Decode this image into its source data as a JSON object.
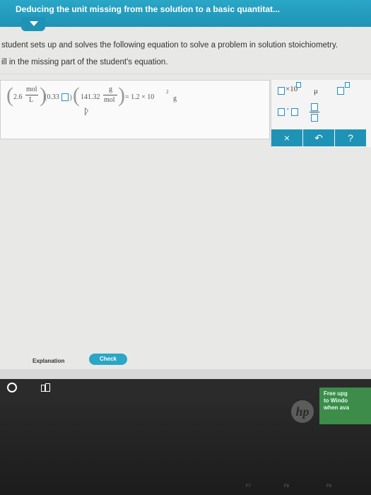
{
  "header": {
    "title": "Deducing the unit missing from the solution to a basic quantitat..."
  },
  "question": {
    "line1": "student sets up and solves the following equation to solve a problem in solution stoichiometry.",
    "line2": "ill in the missing part of the student's equation."
  },
  "equation": {
    "coef1": "2.6",
    "unit1_num": "mol",
    "unit1_den": "L",
    "term2": "(0.33",
    "coef3": "141.32",
    "unit3_num": "g",
    "unit3_den": "mol",
    "result": "= 1.2 × 10",
    "result_exp": "2",
    "result_unit": "g"
  },
  "palette": {
    "sci_label": "×10",
    "mu_label": "μ",
    "dot_label": "·",
    "clear_label": "×",
    "undo_label": "↶",
    "help_label": "?"
  },
  "buttons": {
    "explanation": "Explanation",
    "check": "Check"
  },
  "device": {
    "brand": "hp",
    "sticker_line1": "Free upg",
    "sticker_line2": "to Windo",
    "sticker_line3": "when ava",
    "fkey_f7": "F7",
    "fkey_f8": "F8",
    "fkey_f9": "F9"
  },
  "colors": {
    "accent": "#1f93b6",
    "input_square": "#1e8fc7"
  }
}
